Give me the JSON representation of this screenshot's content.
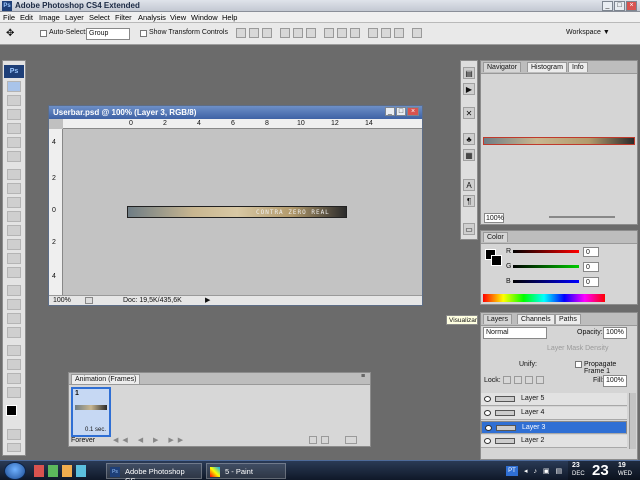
{
  "window": {
    "title": "Adobe Photoshop CS4 Extended",
    "buttons": [
      "_",
      "□",
      "×"
    ]
  },
  "menu": [
    "File",
    "Edit",
    "Image",
    "Layer",
    "Select",
    "Filter",
    "Analysis",
    "View",
    "Window",
    "Help"
  ],
  "options_bar": {
    "auto_select_label": "Auto-Select:",
    "auto_select_value": "Group",
    "show_transform_label": "Show Transform Controls",
    "workspace_label": "Workspace ▼"
  },
  "toolbox": {
    "logo": "Ps"
  },
  "document": {
    "title": "Userbar.psd @ 100% (Layer 3, RGB/8)",
    "ruler_top": [
      "0",
      "2",
      "4",
      "6",
      "8",
      "10",
      "12",
      "14"
    ],
    "ruler_left": [
      "4",
      "2",
      "0",
      "2",
      "4"
    ],
    "userbar_text": "CONTRA ZERO REAL",
    "zoom": "100%",
    "doc_size": "Doc: 19,5K/435,6K"
  },
  "animation": {
    "tab": "Animation (Frames)",
    "frame_number": "1",
    "frame_delay": "0.1 sec.",
    "loop": "Forever"
  },
  "navigator": {
    "tabs": [
      "Navigator",
      "Histogram",
      "Info"
    ],
    "zoom": "100%"
  },
  "color": {
    "tab": "Color",
    "channels": [
      {
        "label": "R",
        "value": "0",
        "color": "#ff0000"
      },
      {
        "label": "G",
        "value": "0",
        "color": "#00cc00"
      },
      {
        "label": "B",
        "value": "0",
        "color": "#0000ff"
      }
    ]
  },
  "layers": {
    "tabs": [
      "Layers",
      "Channels",
      "Paths"
    ],
    "blend_mode": "Normal",
    "opacity_label": "Opacity:",
    "opacity_value": "100%",
    "layer_mask_density": "Layer Mask Density",
    "unify_label": "Unify:",
    "propagate_label": "Propagate Frame 1",
    "lock_label": "Lock:",
    "fill_label": "Fill:",
    "fill_value": "100%",
    "items": [
      {
        "name": "Layer 5",
        "selected": false
      },
      {
        "name": "Layer 4",
        "selected": false
      },
      {
        "name": "Layer 3",
        "selected": true
      },
      {
        "name": "Layer 2",
        "selected": false
      }
    ]
  },
  "tooltip": "Visualizar",
  "taskbar": {
    "items": [
      "Adobe Photoshop CS...",
      "5 - Paint"
    ],
    "lang": "PT",
    "clock_month": "DEC",
    "clock_day_small": "23",
    "clock_day_big": "23",
    "clock_year": "19",
    "clock_weekday": "WED"
  }
}
